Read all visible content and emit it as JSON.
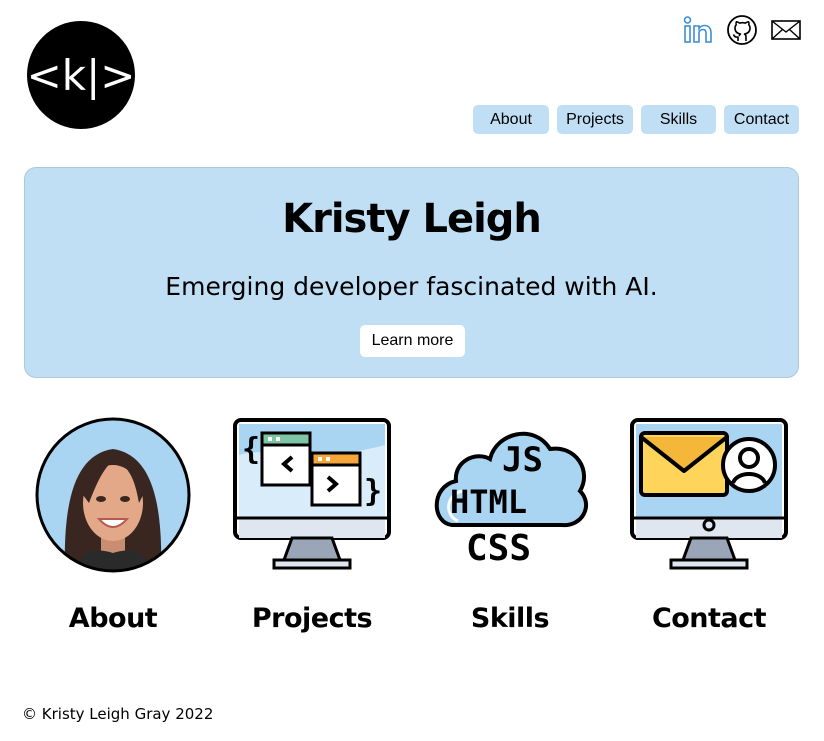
{
  "logo": {
    "text": "<k|>"
  },
  "social": [
    {
      "icon": "linkedin-icon"
    },
    {
      "icon": "github-icon"
    },
    {
      "icon": "mail-icon"
    }
  ],
  "nav": {
    "about": "About",
    "projects": "Projects",
    "skills": "Skills",
    "contact": "Contact"
  },
  "hero": {
    "title": "Kristy Leigh",
    "subtitle": "Emerging developer fascinated with AI.",
    "button": "Learn more"
  },
  "cards": {
    "about": "About",
    "projects": "Projects",
    "skills": "Skills",
    "contact": "Contact"
  },
  "skills_icon_text": {
    "js": "JS",
    "html": "HTML",
    "css": "CSS"
  },
  "footer": "© Kristy Leigh Gray 2022",
  "colors": {
    "accent": "#c0dff5",
    "icon_blue": "#3b8ed3"
  }
}
